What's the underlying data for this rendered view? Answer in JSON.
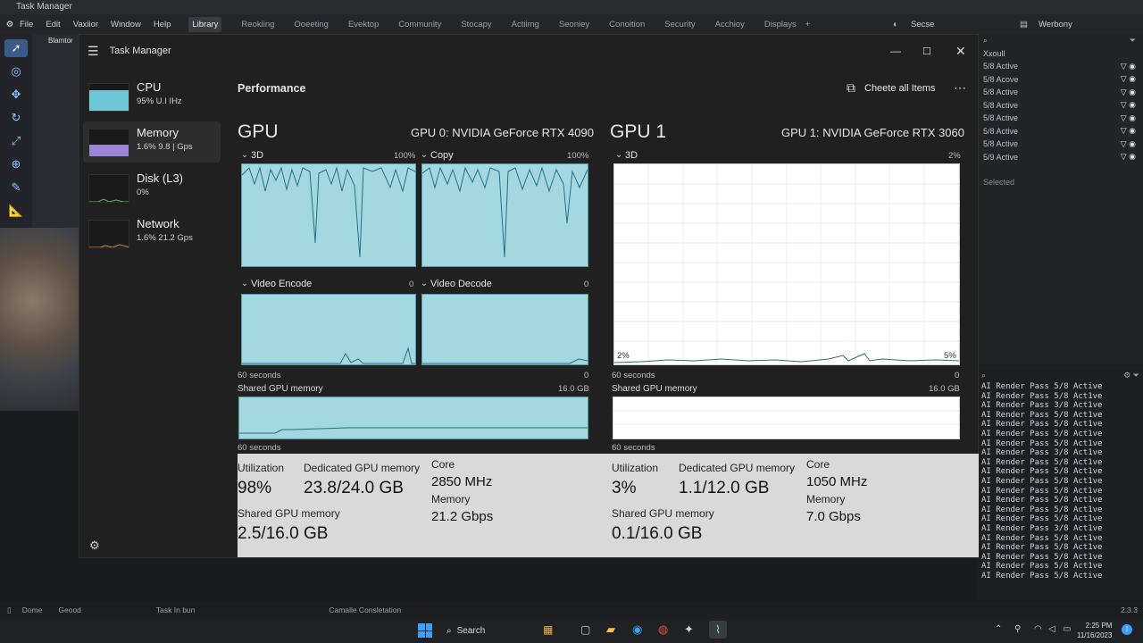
{
  "background_app": {
    "title": "Task Manager",
    "menus": [
      "File",
      "Edit",
      "Vaxiior",
      "Window",
      "Help"
    ],
    "tabs": [
      "Library",
      "Reokiing",
      "Ooeeting",
      "Evektop",
      "Community",
      "Stocapy",
      "Actiimg",
      "Seoniey",
      "Conoition",
      "Security",
      "Acchioy",
      "Displays"
    ],
    "active_tab": "Library",
    "top_right_labels": [
      "Secse",
      "Werbony"
    ],
    "left_snippet": "Blamtor",
    "outliner_header": "Xxoull",
    "outliner_rows": [
      "5/8 Active",
      "5/8 Acove",
      "5/8 Active",
      "5/8 Active",
      "5/8 Active",
      "5/8 Active",
      "5/8 Active",
      "5/9 Active"
    ],
    "outliner_footer": "Selected",
    "console_lines": [
      "AI Render Pass 5/8 Active",
      "AI Render Pass 5/8 Act1ve",
      "AI Render Pass 3/8 Act1ve",
      "AI Render Pass 5/8 Act1ve",
      "AI Render Pass 5/8 Act1ve",
      "AI Render Pass 5/8 Act1ve",
      "AI Render Pass 5/8 Act1ve",
      "AI Render Pass 3/8 Act1ve",
      "AI Render Pass 5/8 Act1ve",
      "AI Render Pass 5/8 Act1ve",
      "AI Render Pass 5/8 Act1ve",
      "AI Render Pass 5/8 Act1ve",
      "AI Render Pass 5/8 Act1ve",
      "AI Render Pass 5/8 Act1ve",
      "AI Render Pass 5/8 Act1ve",
      "AI Render Pass 3/8 Act1ve",
      "AI Render Pass 5/8 Act1ve",
      "AI Render Pass 5/8 Act1ve",
      "AI Render Pass 5/8 Act1ve",
      "AI Render Pass 5/8 Act1ve",
      "AI Render Pass 5/8 Active"
    ],
    "status_items": [
      "Dome",
      "Geood",
      "Task In bun",
      "Camalle Consletation"
    ],
    "status_right": "2.3.3"
  },
  "taskbar": {
    "search": "Search",
    "time": "2:25 PM",
    "date": "11/16/2023"
  },
  "task_manager": {
    "title": "Task Manager",
    "sidebar": [
      {
        "name": "CPU",
        "sub": "95% U.I  IHz"
      },
      {
        "name": "Memory",
        "sub": "1.6%  9.8 | Gps"
      },
      {
        "name": "Disk (L3)",
        "sub": "0%"
      },
      {
        "name": "Network",
        "sub": "1.6%  21.2 Gps"
      }
    ],
    "header": {
      "title": "Performance",
      "action": "Cheete all Items"
    },
    "gpu0": {
      "heading": "GPU",
      "model": "GPU 0: NVIDIA GeForce RTX 4090",
      "graphs": [
        {
          "label": "3D",
          "max": "100%"
        },
        {
          "label": "Copy",
          "max": "100%"
        },
        {
          "label": "Video Encode",
          "max": "0"
        },
        {
          "label": "Video Decode",
          "max": "0"
        }
      ],
      "seconds": "60 seconds",
      "zero": "0",
      "shared_label": "Shared GPU memory",
      "shared_max": "16.0 GB",
      "seconds2": "60 seconds",
      "stats": {
        "util_k": "Utilization",
        "util_v": "98%",
        "ded_k": "Dedicated GPU memory",
        "ded_v": "23.8/24.0 GB",
        "core_k": "Core",
        "core_v": "2850 MHz",
        "mem_k": "Memory",
        "mem_v": "21.2 Gbps",
        "shared_k": "Shared GPU memory",
        "shared_v": "2.5/16.0 GB"
      }
    },
    "gpu1": {
      "heading": "GPU 1",
      "model": "GPU 1: NVIDIA GeForce RTX 3060",
      "graph_label": "3D",
      "graph_max": "2%",
      "left_val": "2%",
      "right_val": "5%",
      "seconds": "60 seconds",
      "zero": "0",
      "shared_label": "Shared GPU memory",
      "shared_max": "16.0 GB",
      "seconds2": "60 seconds",
      "stats": {
        "util_k": "Utilization",
        "util_v": "3%",
        "ded_k": "Dedicated GPU memory",
        "ded_v": "1.1/12.0 GB",
        "core_k": "Core",
        "core_v": "1050 MHz",
        "mem_k": "Memory",
        "mem_v": "7.0 Gbps",
        "shared_k": "Shared GPU memory",
        "shared_v": "0.1/16.0 GB"
      }
    }
  },
  "colors": {
    "graph_fill": "#a4d8e0",
    "graph_line": "#2a6f80",
    "memory_thumb": "#9b86d8",
    "panel_bg": "#202020",
    "stats_bg": "#d9d9da"
  }
}
